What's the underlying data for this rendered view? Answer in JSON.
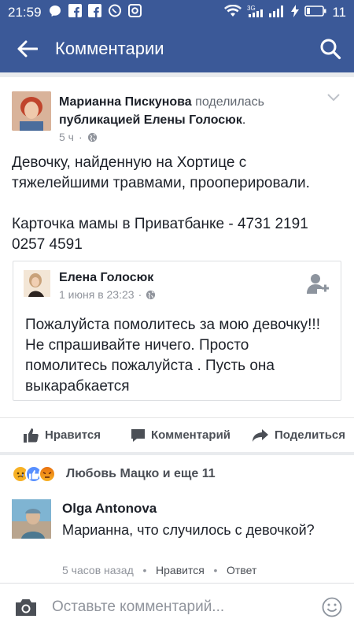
{
  "status_bar": {
    "time": "21:59",
    "battery": "11",
    "network": "3G"
  },
  "app_bar": {
    "title": "Комментарии"
  },
  "post": {
    "author": "Марианна Пискунова",
    "shared_verb": "поделилась",
    "shared_object": "публикацией Елены Голосюк",
    "time": "5 ч",
    "text_line1": "Девочку, найденную на Хортице с тяжелейшими травмами, прооперировали.",
    "text_line2": "Карточка мамы в Приватбанке - 4731 2191 0257 4591",
    "shared": {
      "author": "Елена Голосюк",
      "time": "1 июня в 23:23",
      "text": "Пожалуйста помолитесь за мою девочку!!! Не спрашивайте ничего. Просто помолитесь пожалуйста . Пусть она выкарабкается"
    },
    "actions": {
      "like": "Нравится",
      "comment": "Комментарий",
      "share": "Поделиться"
    }
  },
  "reactions": {
    "summary": "Любовь Мацко и еще 11"
  },
  "comment": {
    "author": "Olga Antonova",
    "text": "Марианна, что случилось с девочкой?",
    "time": "5 часов назад",
    "like": "Нравится",
    "reply": "Ответ",
    "sep": "•"
  },
  "composer": {
    "placeholder": "Оставьте комментарий..."
  },
  "colors": {
    "brand": "#3b5998",
    "muted": "#90949c"
  }
}
